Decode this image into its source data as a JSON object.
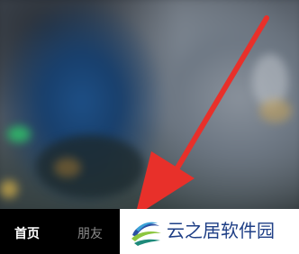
{
  "bottom_nav": {
    "tabs": [
      {
        "label": "首页",
        "active": true
      },
      {
        "label": "朋友",
        "active": false
      }
    ]
  },
  "watermark": {
    "text": "云之居软件园"
  },
  "colors": {
    "annotation_arrow": "#e8302a",
    "watermark_text": "#1f3f86",
    "nav_background": "#000000"
  },
  "icons": {
    "annotation": "red-arrow-icon",
    "watermark_logo": "yunzhiju-logo-icon"
  }
}
